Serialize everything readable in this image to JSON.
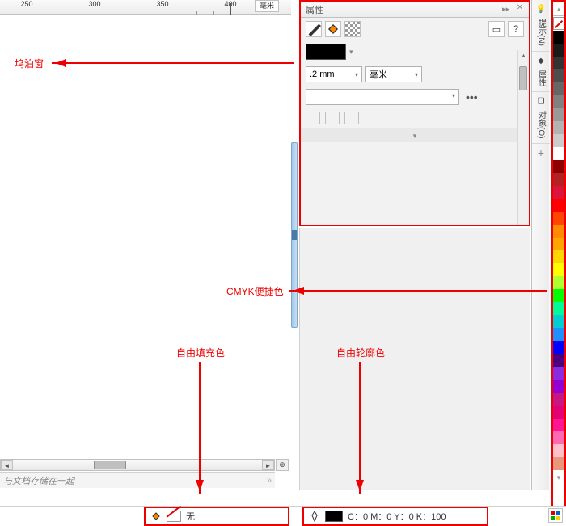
{
  "ruler": {
    "marks": [
      250,
      300,
      350,
      400
    ],
    "unit_label": "毫米"
  },
  "docker": {
    "title": "属性",
    "width_value": ".2 mm",
    "unit_value": "毫米",
    "close": "✕",
    "expand_glyph": "▾",
    "more_glyph": "•••"
  },
  "tabs": {
    "hint": {
      "label": "提示(N)"
    },
    "props": {
      "label": "属性"
    },
    "objects": {
      "label": "对象(O)"
    },
    "plus": "+"
  },
  "hint": {
    "text": "与文档存储在一起",
    "more": "»"
  },
  "status": {
    "fill_label": "无",
    "outline_label": "C：0 M：0 Y：0 K：100"
  },
  "annotations": {
    "dock_window": "坞泊窗",
    "cmyk_palette": "CMYK便捷色",
    "free_fill": "自由填充色",
    "free_outline": "自由轮廓色"
  },
  "palette_colors": [
    "#000000",
    "#1a1a1a",
    "#333333",
    "#4d4d4d",
    "#666666",
    "#808080",
    "#999999",
    "#b3b3b3",
    "#cccccc",
    "#ffffff",
    "#8b0000",
    "#b22222",
    "#dc143c",
    "#ff0000",
    "#ff4500",
    "#ff8c00",
    "#ffa500",
    "#ffd700",
    "#ffff00",
    "#adff2f",
    "#00ff00",
    "#00fa9a",
    "#00ced1",
    "#1e90ff",
    "#0000ff",
    "#4b0082",
    "#8a2be2",
    "#9400d3",
    "#c71585",
    "#e30074",
    "#ff1493",
    "#ff69b4",
    "#ffc0cb",
    "#e9967a",
    "#8b4513",
    "#556b2f",
    "#2f4f4f",
    "#708090"
  ]
}
